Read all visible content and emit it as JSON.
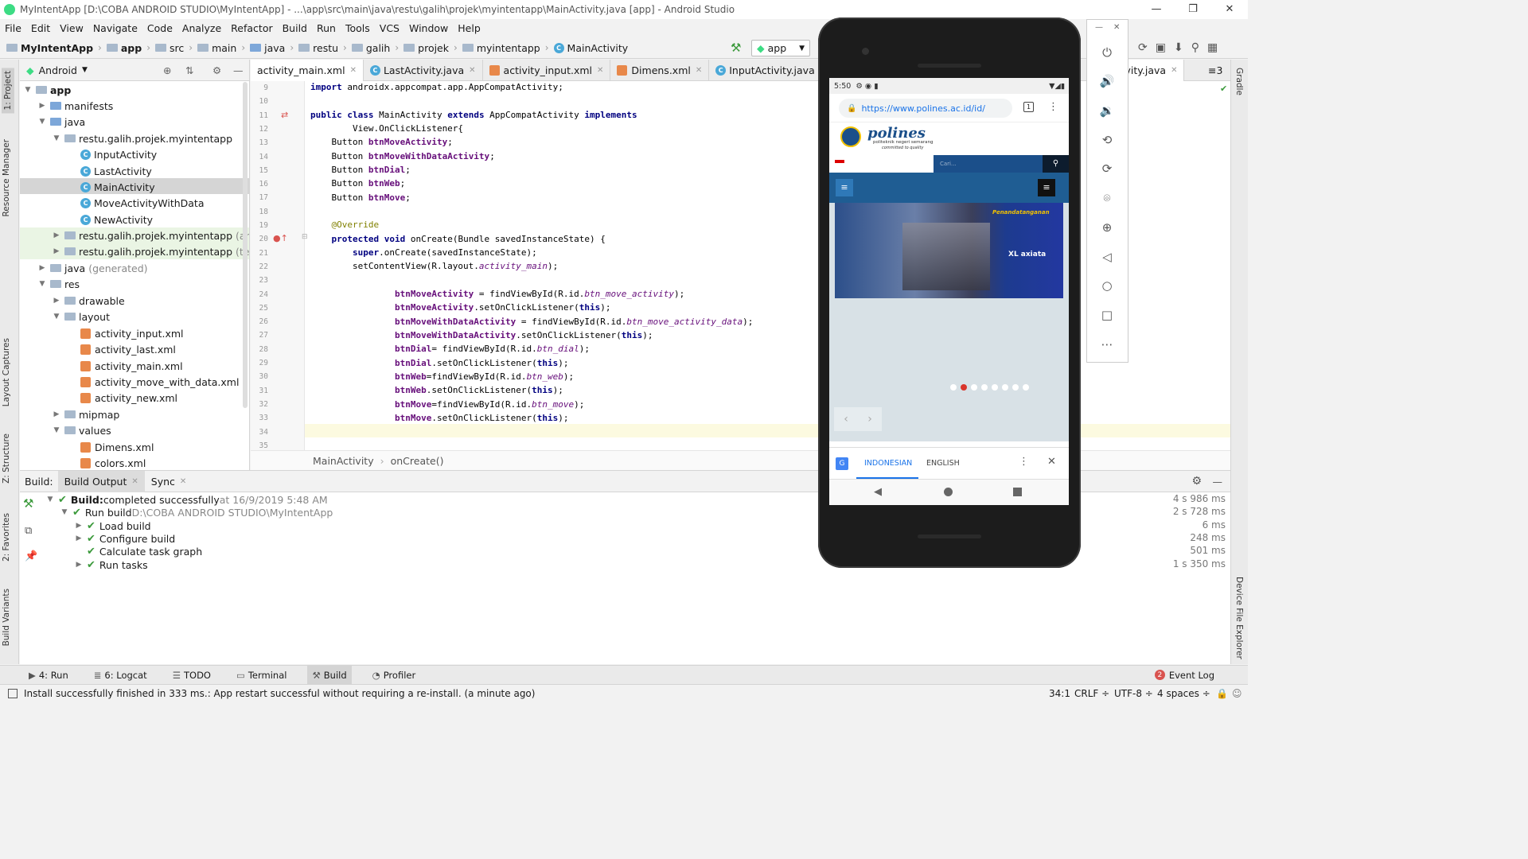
{
  "window": {
    "title": "MyIntentApp [D:\\COBA ANDROID STUDIO\\MyIntentApp] - ...\\app\\src\\main\\java\\restu\\galih\\projek\\myintentapp\\MainActivity.java [app] - Android Studio",
    "controls": [
      "—",
      "❐",
      "✕"
    ]
  },
  "menu": [
    "File",
    "Edit",
    "View",
    "Navigate",
    "Code",
    "Analyze",
    "Refactor",
    "Build",
    "Run",
    "Tools",
    "VCS",
    "Window",
    "Help"
  ],
  "breadcrumb": [
    "MyIntentApp",
    "app",
    "src",
    "main",
    "java",
    "restu",
    "galih",
    "projek",
    "myintentapp",
    "MainActivity"
  ],
  "run_config": "app",
  "left_tools": {
    "project": "1: Project",
    "resource_manager": "Resource Manager",
    "layout_captures": "Layout Captures",
    "structure": "Z: Structure",
    "favorites": "2: Favorites",
    "build_variants": "Build Variants"
  },
  "right_tools": {
    "gradle": "Gradle",
    "device_file_explorer": "Device File Explorer"
  },
  "project": {
    "view": "Android",
    "tree": [
      {
        "label": "app",
        "level": 0
      },
      {
        "label": "manifests",
        "level": 1
      },
      {
        "label": "java",
        "level": 1
      },
      {
        "label": "restu.galih.projek.myintentapp",
        "level": 2
      },
      {
        "label": "InputActivity",
        "level": 3
      },
      {
        "label": "LastActivity",
        "level": 3
      },
      {
        "label": "MainActivity",
        "level": 3
      },
      {
        "label": "MoveActivityWithData",
        "level": 3
      },
      {
        "label": "NewActivity",
        "level": 3
      },
      {
        "label": "restu.galih.projek.myintentapp",
        "suffix": "(androidTest)",
        "level": 2
      },
      {
        "label": "restu.galih.projek.myintentapp",
        "suffix": "(test)",
        "level": 2
      },
      {
        "label": "java",
        "suffix": "(generated)",
        "level": 1
      },
      {
        "label": "res",
        "level": 1
      },
      {
        "label": "drawable",
        "level": 2
      },
      {
        "label": "layout",
        "level": 2
      },
      {
        "label": "activity_input.xml",
        "level": 3
      },
      {
        "label": "activity_last.xml",
        "level": 3
      },
      {
        "label": "activity_main.xml",
        "level": 3
      },
      {
        "label": "activity_move_with_data.xml",
        "level": 3
      },
      {
        "label": "activity_new.xml",
        "level": 3
      },
      {
        "label": "mipmap",
        "level": 2
      },
      {
        "label": "values",
        "level": 2
      },
      {
        "label": "Dimens.xml",
        "level": 3
      },
      {
        "label": "colors.xml",
        "level": 3
      }
    ]
  },
  "editor": {
    "tabs": [
      "activity_main.xml",
      "LastActivity.java",
      "activity_input.xml",
      "Dimens.xml",
      "InputActivity.java",
      "activi"
    ],
    "right_tab": "nActivity.java",
    "tab_overflow": "≡3",
    "line_numbers": [
      "9",
      "10",
      "11",
      "12",
      "13",
      "14",
      "15",
      "16",
      "17",
      "18",
      "19",
      "20",
      "21",
      "22",
      "23",
      "24",
      "25",
      "26",
      "27",
      "28",
      "29",
      "30",
      "31",
      "32",
      "33",
      "34",
      "35"
    ],
    "breadcrumb": [
      "MainActivity",
      "onCreate()"
    ]
  },
  "build": {
    "label": "Build:",
    "tabs": [
      "Build Output",
      "Sync"
    ],
    "rows": [
      {
        "bold": "Build:",
        "text": " completed successfully",
        "meta": " at 16/9/2019 5:48 AM",
        "time": "4 s 986 ms"
      },
      {
        "text": "Run build ",
        "meta": "D:\\COBA ANDROID STUDIO\\MyIntentApp",
        "time": "2 s 728 ms"
      },
      {
        "text": "Load build",
        "time": "6 ms"
      },
      {
        "text": "Configure build",
        "time": "248 ms"
      },
      {
        "text": "Calculate task graph",
        "time": "501 ms"
      },
      {
        "text": "Run tasks",
        "time": "1 s 350 ms"
      }
    ]
  },
  "bottom_tools": {
    "run": "4: Run",
    "logcat": "6: Logcat",
    "todo": "TODO",
    "terminal": "Terminal",
    "build": "Build",
    "profiler": "Profiler",
    "event_log": "Event Log",
    "event_count": "2"
  },
  "status": {
    "message": "Install successfully finished in 333 ms.: App restart successful without requiring a re-install. (a minute ago)",
    "position": "34:1",
    "line_sep": "CRLF ÷",
    "encoding": "UTF-8 ÷",
    "indent": "4 spaces ÷"
  },
  "device": {
    "time": "5:50",
    "url": "https://www.polines.ac.id/id/",
    "tab_count": "1",
    "site_name": "polines",
    "site_sub": "politeknik negeri semarang",
    "site_tag": "committed to quality",
    "search_placeholder": "Cari...",
    "banner_title": "Penandatanganan",
    "banner_brand": "XL axiata",
    "translate": {
      "lang1": "INDONESIAN",
      "lang2": "ENGLISH"
    },
    "carousel_dots": 8,
    "carousel_active": 2
  },
  "colors": {
    "accent": "#2a6fb6",
    "polines_blue": "#1b4f8a",
    "translate_blue": "#1a73e8",
    "nav_dark": "#1a1a1a"
  }
}
